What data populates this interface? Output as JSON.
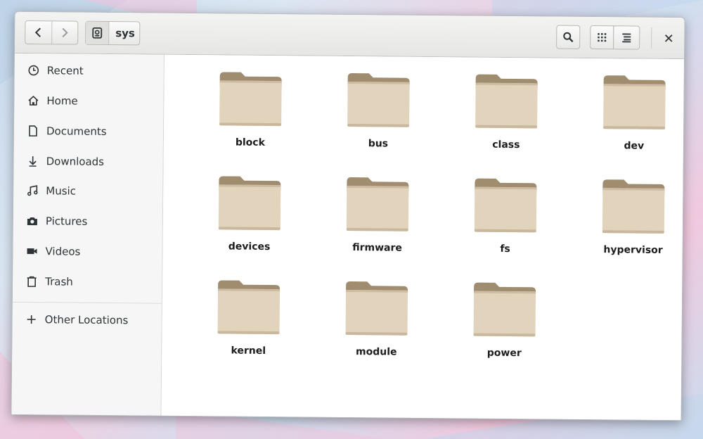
{
  "header": {
    "path_segment": "sys"
  },
  "sidebar": {
    "items": [
      {
        "label": "Recent",
        "icon": "clock-icon"
      },
      {
        "label": "Home",
        "icon": "home-icon"
      },
      {
        "label": "Documents",
        "icon": "document-icon"
      },
      {
        "label": "Downloads",
        "icon": "download-icon"
      },
      {
        "label": "Music",
        "icon": "music-icon"
      },
      {
        "label": "Pictures",
        "icon": "camera-icon"
      },
      {
        "label": "Videos",
        "icon": "video-icon"
      },
      {
        "label": "Trash",
        "icon": "trash-icon"
      }
    ],
    "other_locations": {
      "label": "Other Locations",
      "icon": "plus-icon"
    }
  },
  "folders": [
    {
      "name": "block"
    },
    {
      "name": "bus"
    },
    {
      "name": "class"
    },
    {
      "name": "dev"
    },
    {
      "name": "devices"
    },
    {
      "name": "firmware"
    },
    {
      "name": "fs"
    },
    {
      "name": "hypervisor"
    },
    {
      "name": "kernel"
    },
    {
      "name": "module"
    },
    {
      "name": "power"
    }
  ],
  "colors": {
    "folder_body": "#e2d3bd",
    "folder_back": "#a08c6e",
    "accent": "#2e3436"
  }
}
